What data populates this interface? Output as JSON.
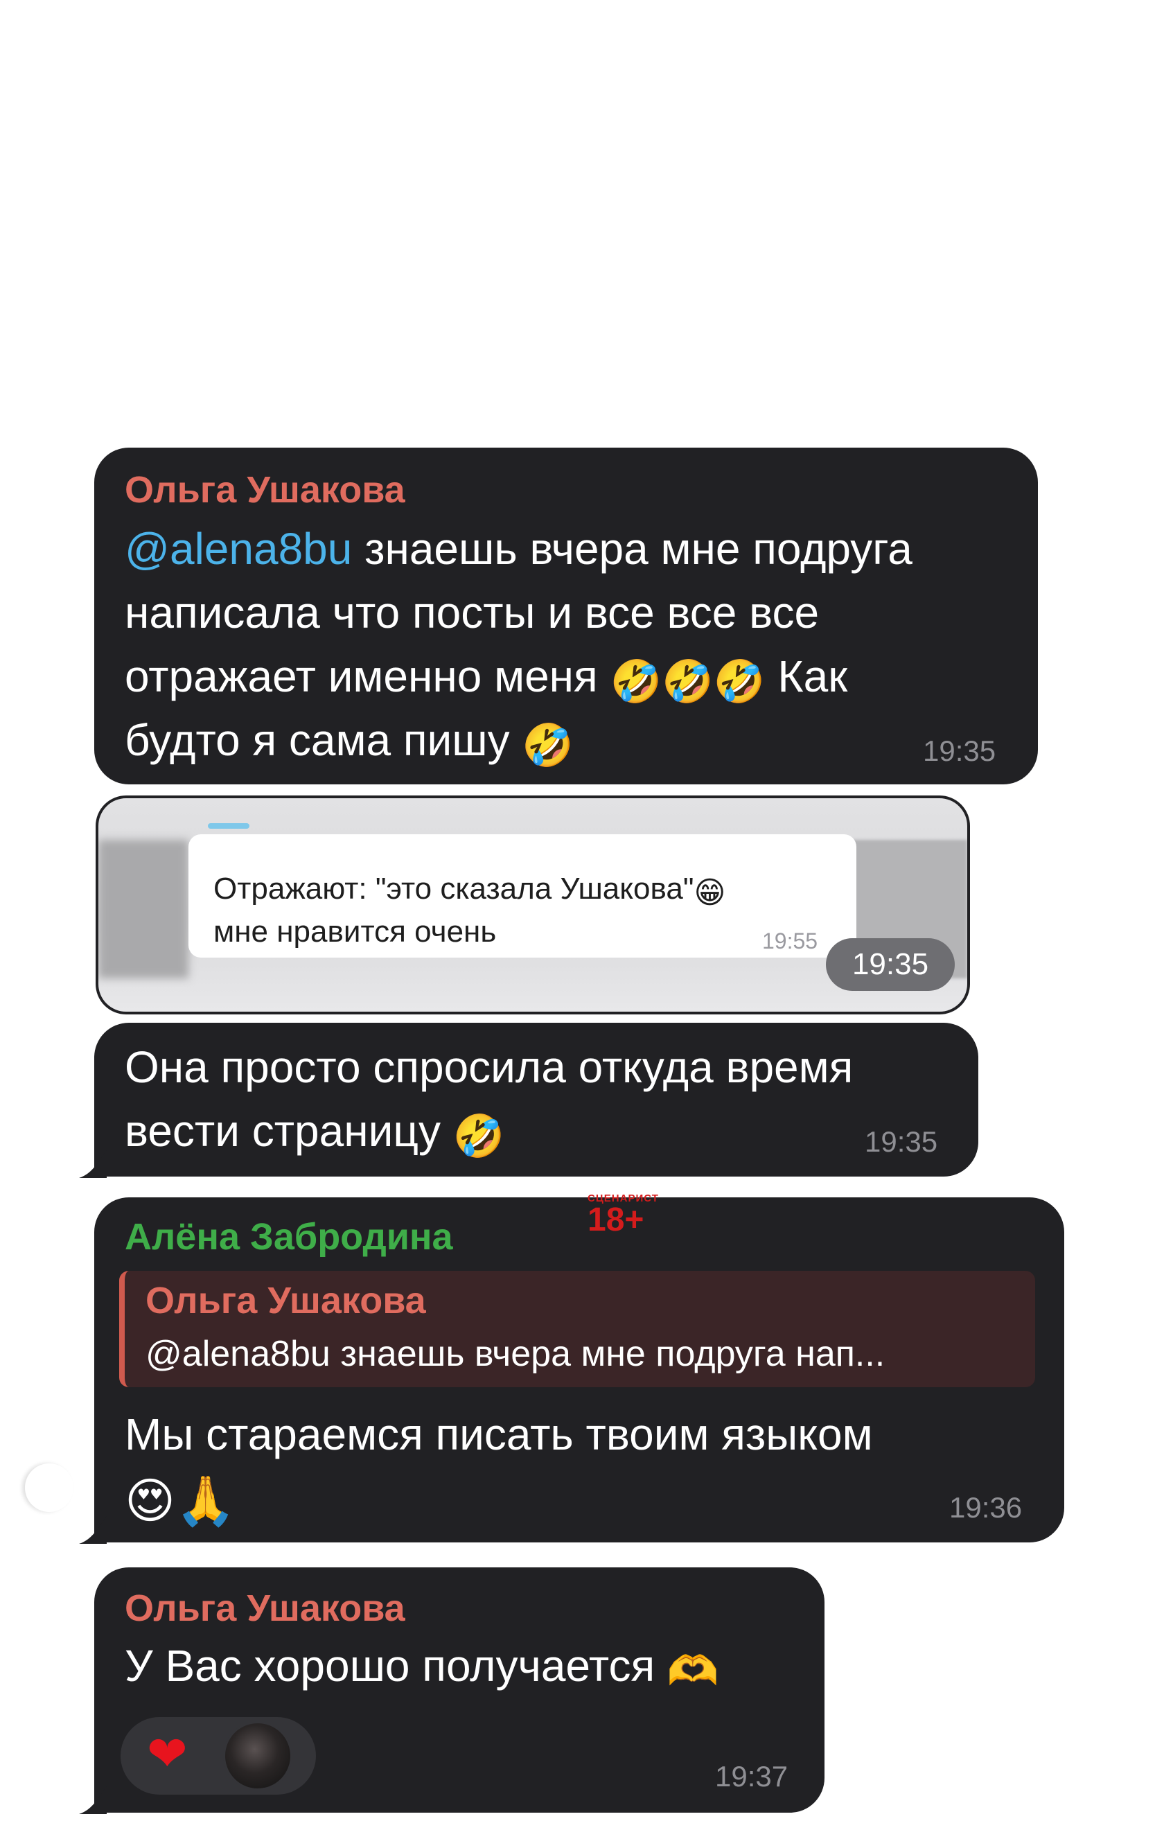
{
  "messages": [
    {
      "sender": "Ольга Ушакова",
      "mention": "@alena8bu",
      "lines": [
        " знаешь вчера мне подруга",
        "написала что посты и все все все",
        "отражает именно меня",
        "будто я сама пишу"
      ],
      "mid_text": "Как",
      "time": "19:35"
    },
    {
      "type": "screenshot",
      "inner_text_1": "Отражают: \"это сказала Ушакова\"",
      "inner_text_2": "мне нравится очень",
      "inner_time": "19:55",
      "time": "19:35"
    },
    {
      "lines": [
        "Она просто спросила откуда время",
        "вести страницу"
      ],
      "time": "19:35"
    },
    {
      "sender": "Алёна Забродина",
      "badge_top": "СЦЕНАРИСТ",
      "badge_main": "18+",
      "reply_sender": "Ольга Ушакова",
      "reply_text": "@alena8bu знаешь вчера мне подруга нап...",
      "lines": [
        "Мы стараемся писать твоим языком"
      ],
      "time": "19:36"
    },
    {
      "sender": "Ольга Ушакова",
      "lines": [
        "У Вас хорошо получается"
      ],
      "reaction": "❤",
      "time": "19:37"
    }
  ],
  "icons": {
    "laugh": "rolling-on-floor-laughing-emoji",
    "grin": "grinning-squinting-emoji",
    "heart_eyes": "heart-eyes-emoji",
    "pray": "folded-hands-emoji",
    "heart_hands": "heart-hands-emoji",
    "heart": "red-heart-icon"
  },
  "colors": {
    "bubble": "#212124",
    "sender_red": "#e06c5f",
    "sender_green": "#3fae49",
    "mention": "#4cb3ea",
    "time": "#8f8f94"
  }
}
